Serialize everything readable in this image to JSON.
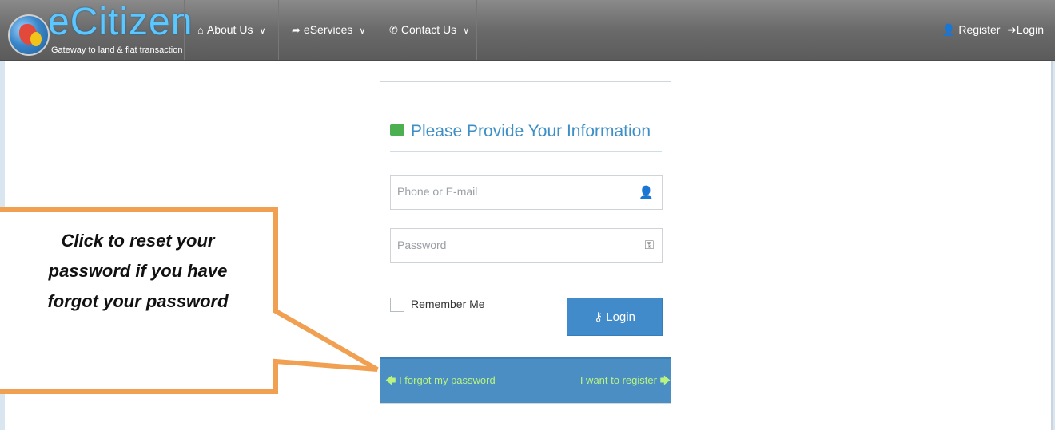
{
  "navbar": {
    "brand_name": "eCitizen",
    "brand_tagline": "Gateway to land & flat transaction",
    "items": [
      {
        "label": "About Us",
        "icon": "home-icon"
      },
      {
        "label": "eServices",
        "icon": "share-icon"
      },
      {
        "label": "Contact Us",
        "icon": "phone-icon"
      }
    ],
    "register_label": "Register",
    "login_label": "Login"
  },
  "login_panel": {
    "title": "Please Provide Your Information",
    "phone_placeholder": "Phone or E-mail",
    "password_placeholder": "Password",
    "remember_label": "Remember Me",
    "login_button": "Login",
    "forgot_link": "I forgot my password",
    "register_link": "I want to register"
  },
  "callout": {
    "line1": "Click to reset your",
    "line2": "password if you have",
    "line3": "forgot your password"
  },
  "colors": {
    "accent": "#428bca",
    "footer": "#4a8ec3",
    "link_green": "#b9f47e",
    "callout_border": "#f0a050"
  }
}
